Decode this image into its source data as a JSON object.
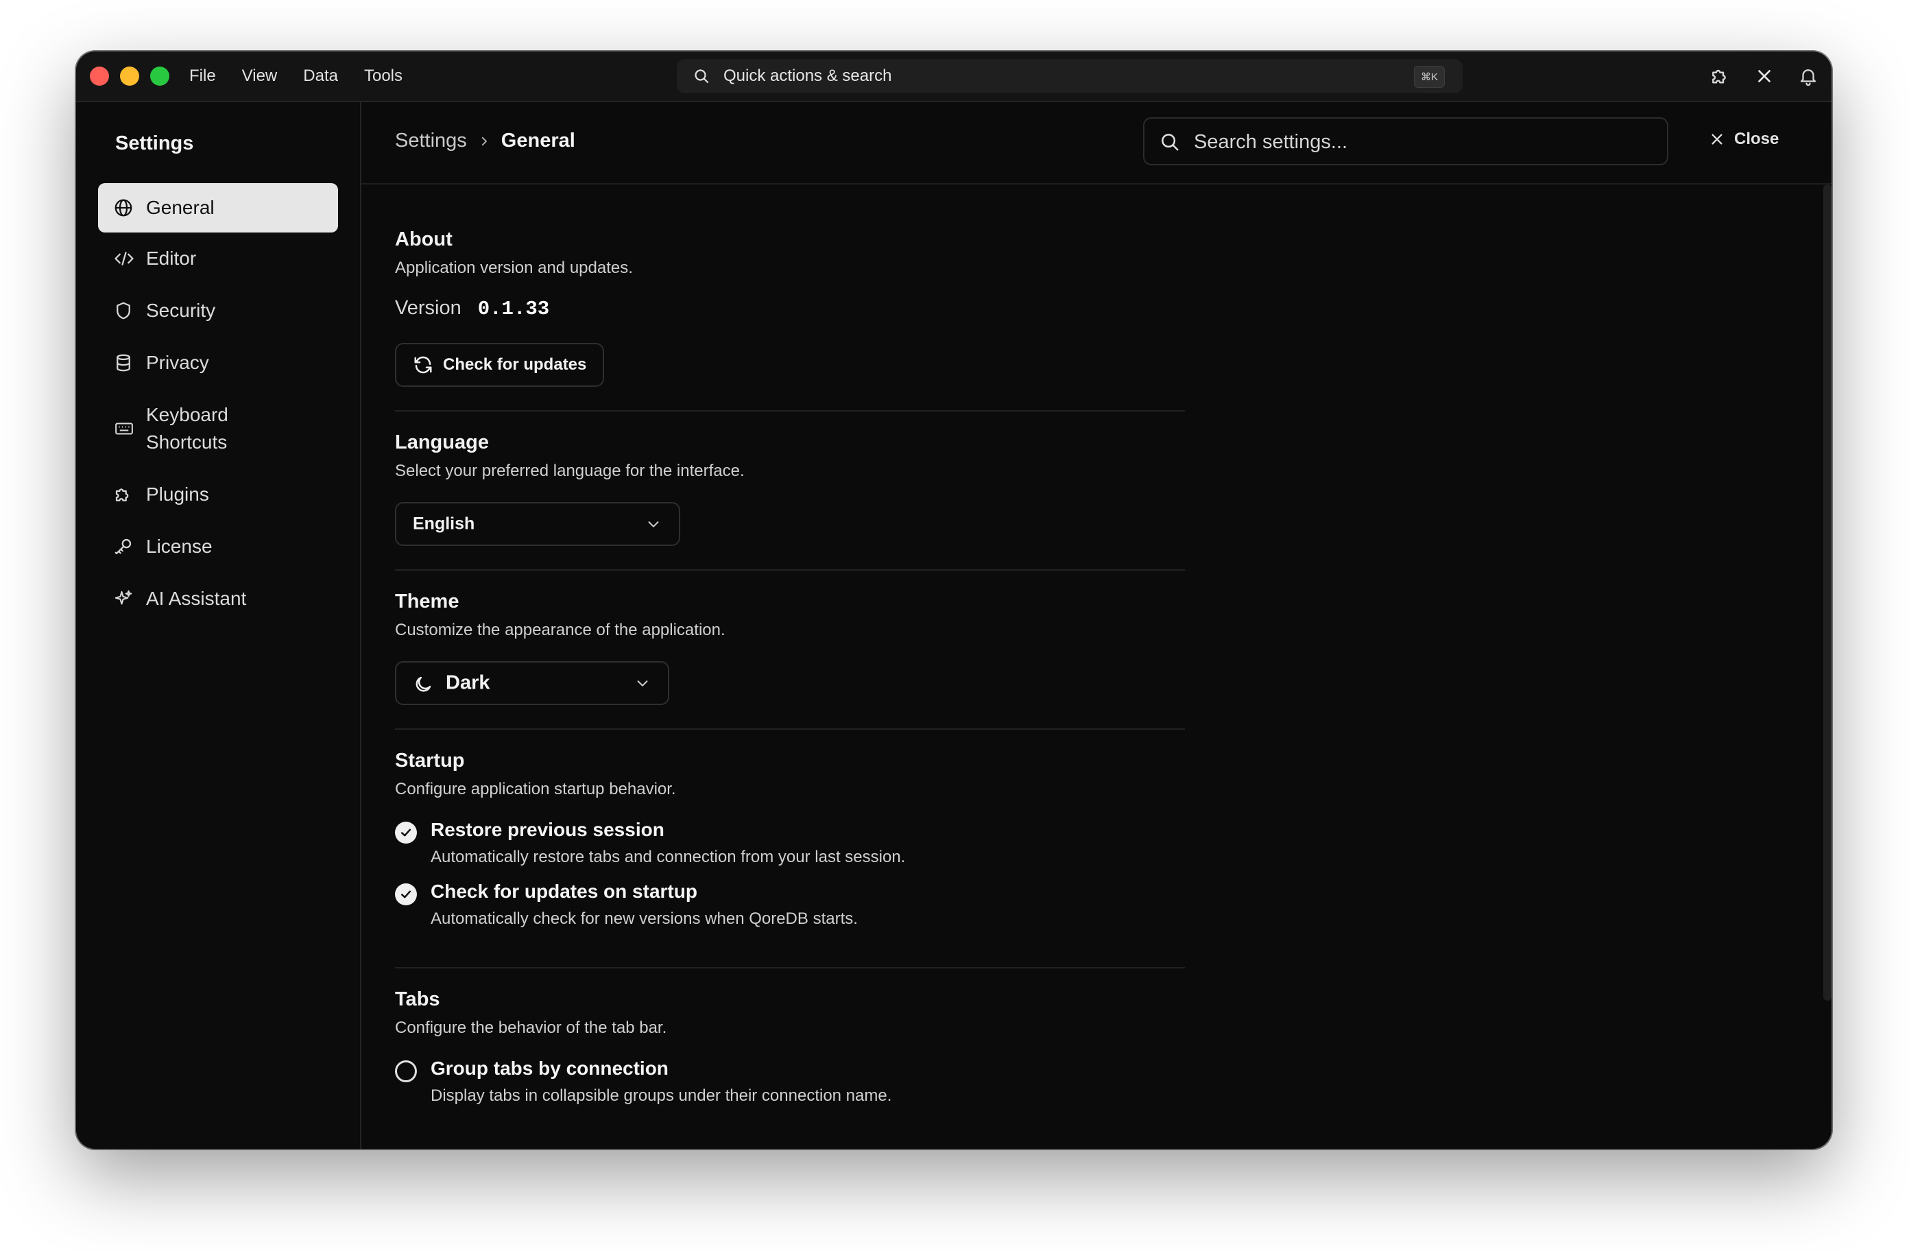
{
  "menubar": {
    "items": [
      "File",
      "View",
      "Data",
      "Tools"
    ]
  },
  "quick_search": {
    "label": "Quick actions & search",
    "shortcut": "⌘K"
  },
  "titlebar_icons": [
    "puzzle-icon",
    "close-icon",
    "bell-icon"
  ],
  "sidebar": {
    "title": "Settings",
    "items": [
      {
        "label": "General",
        "icon": "globe-icon",
        "active": true
      },
      {
        "label": "Editor",
        "icon": "code-icon"
      },
      {
        "label": "Security",
        "icon": "shield-icon"
      },
      {
        "label": "Privacy",
        "icon": "database-icon"
      },
      {
        "label": "Keyboard Shortcuts",
        "icon": "keyboard-icon"
      },
      {
        "label": "Plugins",
        "icon": "puzzle-icon"
      },
      {
        "label": "License",
        "icon": "key-icon"
      },
      {
        "label": "AI Assistant",
        "icon": "sparkles-icon"
      }
    ]
  },
  "header": {
    "breadcrumb_root": "Settings",
    "breadcrumb_current": "General",
    "search_placeholder": "Search settings...",
    "close_label": "Close"
  },
  "about": {
    "title": "About",
    "description": "Application version and updates.",
    "version_label": "Version",
    "version_value": "0.1.33",
    "check_updates_label": "Check for updates"
  },
  "language": {
    "title": "Language",
    "description": "Select your preferred language for the interface.",
    "selected": "English"
  },
  "theme": {
    "title": "Theme",
    "description": "Customize the appearance of the application.",
    "selected": "Dark"
  },
  "startup": {
    "title": "Startup",
    "description": "Configure application startup behavior.",
    "options": [
      {
        "label": "Restore previous session",
        "description": "Automatically restore tabs and connection from your last session.",
        "checked": true
      },
      {
        "label": "Check for updates on startup",
        "description": "Automatically check for new versions when QoreDB starts.",
        "checked": true
      }
    ]
  },
  "tabs": {
    "title": "Tabs",
    "description": "Configure the behavior of the tab bar.",
    "options": [
      {
        "label": "Group tabs by connection",
        "description": "Display tabs in collapsible groups under their connection name.",
        "checked": false
      }
    ]
  },
  "colors": {
    "window_bg": "#0b0b0b",
    "titlebar_bg": "#141414",
    "active_nav_bg": "#e6e6e6",
    "traffic_red": "#ff5f57",
    "traffic_yellow": "#febc2e",
    "traffic_green": "#28c840"
  }
}
